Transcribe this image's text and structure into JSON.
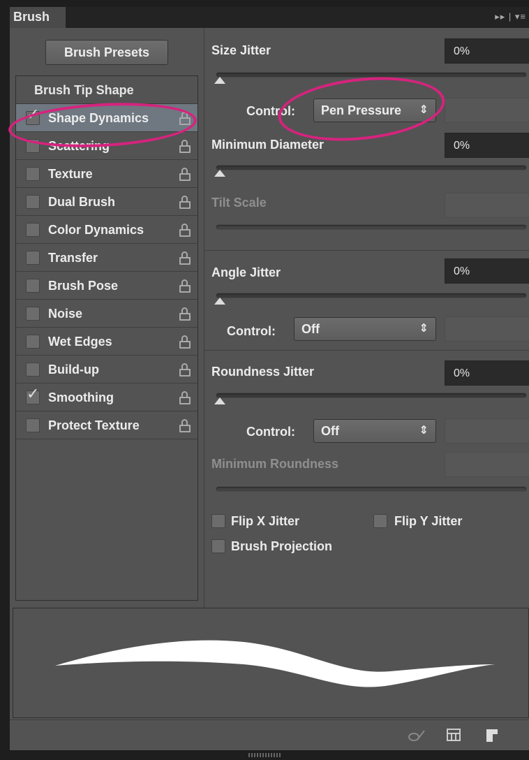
{
  "panel": {
    "tab_label": "Brush",
    "header_icons": "▸▸ | ▾≡"
  },
  "left": {
    "presets_button": "Brush Presets",
    "tip_shape_label": "Brush Tip Shape",
    "items": [
      {
        "label": "Shape Dynamics",
        "checked": true,
        "selected": true
      },
      {
        "label": "Scattering",
        "checked": false
      },
      {
        "label": "Texture",
        "checked": false
      },
      {
        "label": "Dual Brush",
        "checked": false
      },
      {
        "label": "Color Dynamics",
        "checked": false
      },
      {
        "label": "Transfer",
        "checked": false
      },
      {
        "label": "Brush Pose",
        "checked": false
      },
      {
        "label": "Noise",
        "checked": false
      },
      {
        "label": "Wet Edges",
        "checked": false
      },
      {
        "label": "Build-up",
        "checked": false
      },
      {
        "label": "Smoothing",
        "checked": true
      },
      {
        "label": "Protect Texture",
        "checked": false
      }
    ]
  },
  "right": {
    "size_jitter_label": "Size Jitter",
    "size_jitter_value": "0%",
    "control_label": "Control:",
    "size_control_value": "Pen Pressure",
    "min_diameter_label": "Minimum Diameter",
    "min_diameter_value": "0%",
    "tilt_scale_label": "Tilt Scale",
    "angle_jitter_label": "Angle Jitter",
    "angle_jitter_value": "0%",
    "angle_control_value": "Off",
    "roundness_jitter_label": "Roundness Jitter",
    "roundness_jitter_value": "0%",
    "roundness_control_value": "Off",
    "min_roundness_label": "Minimum Roundness",
    "flip_x_label": "Flip X Jitter",
    "flip_y_label": "Flip Y Jitter",
    "brush_projection_label": "Brush Projection"
  },
  "colors": {
    "annotation": "#d6237e",
    "panel_bg": "#535353",
    "selected_row": "#6f7781"
  },
  "icons": [
    "lock-icon",
    "brush-toggle-icon",
    "grid-icon",
    "new-preset-icon",
    "dropdown-arrows-icon",
    "panel-menu-icon"
  ]
}
